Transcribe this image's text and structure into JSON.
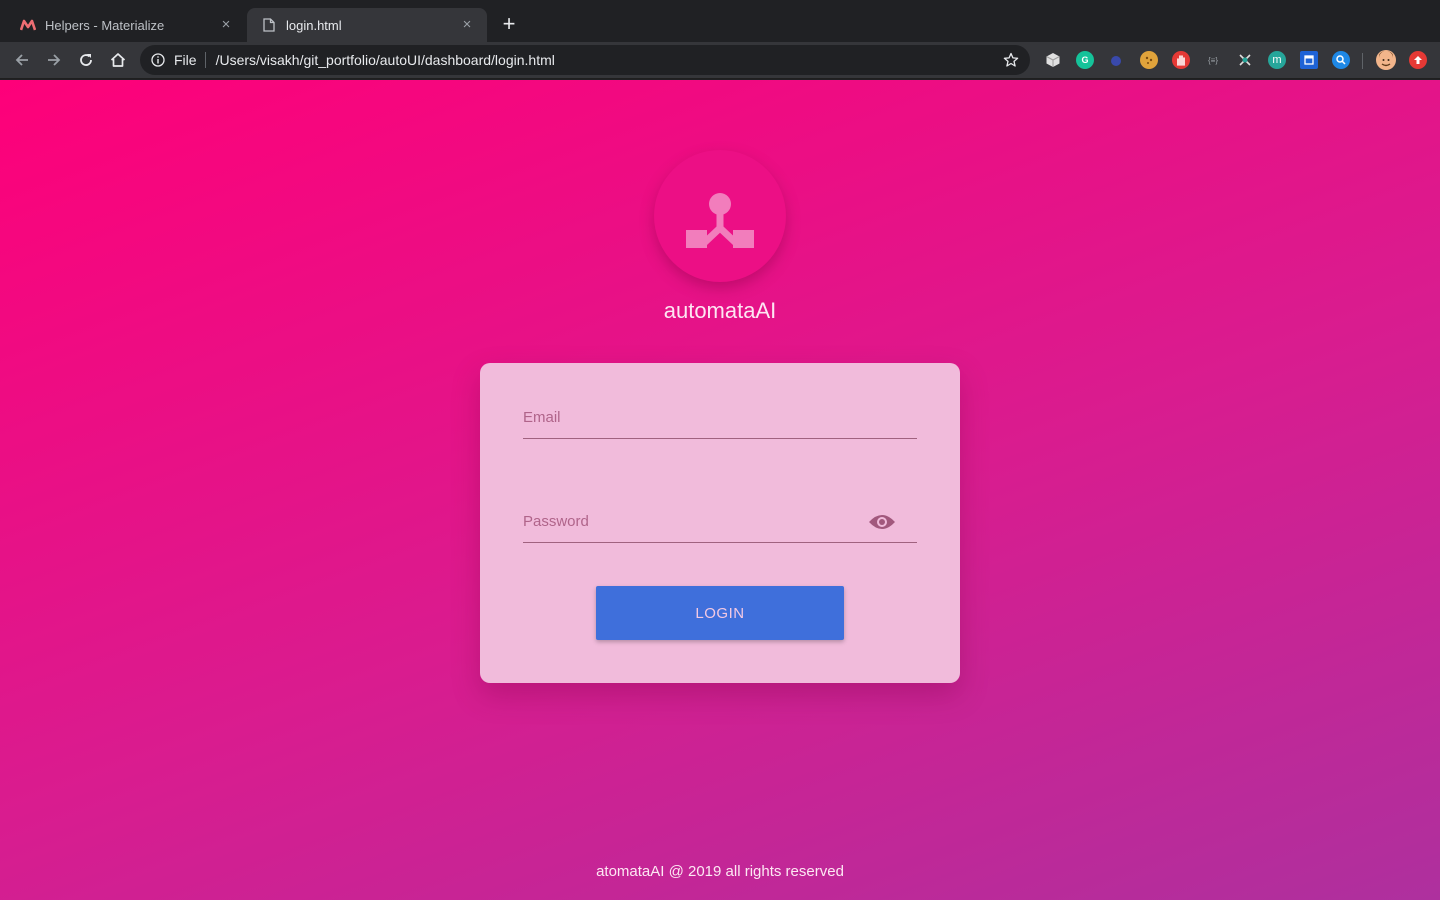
{
  "browser": {
    "tabs": [
      {
        "title": "Helpers - Materialize",
        "active": false,
        "icon": "materialize-icon",
        "close": "×"
      },
      {
        "title": "login.html",
        "active": true,
        "icon": "file-icon",
        "close": "×"
      }
    ],
    "new_tab": "+",
    "address": {
      "scheme": "File",
      "url": "/Users/visakh/git_portfolio/autoUI/dashboard/login.html"
    },
    "extensions": [
      "cube-extension",
      "grammarly-extension",
      "dark-moon-extension",
      "cookie-extension",
      "hand-stop-extension",
      "json-extension",
      "bug-extension",
      "mercury-extension",
      "window-extension",
      "search-extension",
      "avatar",
      "update-extension"
    ],
    "extension_labels": {
      "json": "{≡}",
      "mercury": "m",
      "grammarly": "G"
    }
  },
  "page": {
    "brand": "automataAI",
    "email_placeholder": "Email",
    "password_placeholder": "Password",
    "login_label": "LOGIN",
    "footer": "atomataAI @ 2019 all rights reserved"
  },
  "colors": {
    "gradient_start": "#fe0079",
    "gradient_end": "#ae309e",
    "card": "#f1bbdb",
    "button": "#3f6fdb"
  }
}
